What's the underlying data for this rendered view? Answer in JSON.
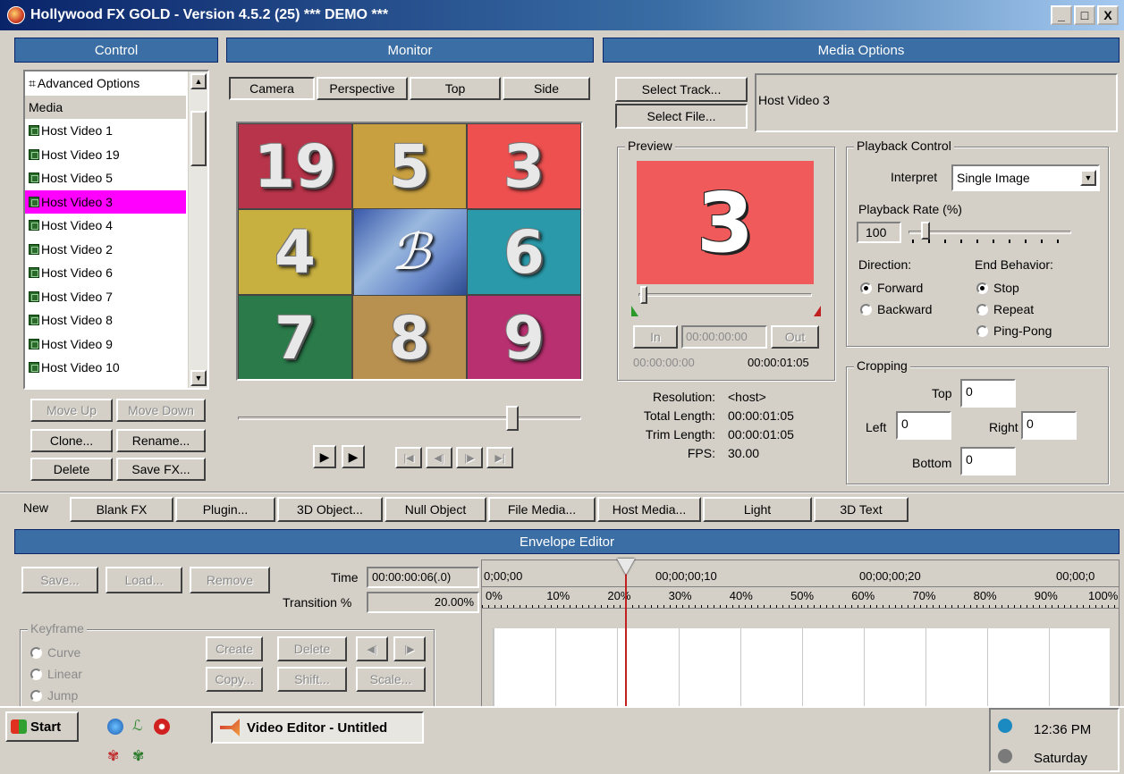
{
  "window": {
    "title": "Hollywood FX GOLD - Version 4.5.2 (25) *** DEMO ***",
    "buttons": {
      "minimize": "_",
      "maximize": "□",
      "close": "X"
    }
  },
  "control": {
    "header": "Control",
    "list_items": [
      {
        "label": "Advanced Options",
        "icon": "settings-icon"
      },
      {
        "label": "Media",
        "icon": ""
      },
      {
        "label": "Host Video 1",
        "icon": "film-icon"
      },
      {
        "label": "Host Video 19",
        "icon": "film-icon"
      },
      {
        "label": "Host Video 5",
        "icon": "film-icon"
      },
      {
        "label": "Host Video 3",
        "icon": "film-icon",
        "selected": true
      },
      {
        "label": "Host Video 4",
        "icon": "film-icon"
      },
      {
        "label": "Host Video 2",
        "icon": "film-icon"
      },
      {
        "label": "Host Video 6",
        "icon": "film-icon"
      },
      {
        "label": "Host Video 7",
        "icon": "film-icon"
      },
      {
        "label": "Host Video 8",
        "icon": "film-icon"
      },
      {
        "label": "Host Video 9",
        "icon": "film-icon"
      },
      {
        "label": "Host Video 10",
        "icon": "film-icon"
      }
    ],
    "move_up": "Move Up",
    "move_down": "Move Down",
    "clone": "Clone...",
    "rename": "Rename...",
    "delete": "Delete",
    "save_fx": "Save FX..."
  },
  "monitor": {
    "header": "Monitor",
    "tabs": [
      "Camera",
      "Perspective",
      "Top",
      "Side"
    ],
    "active_tab": "Camera",
    "tiles": [
      "19",
      "5",
      "3",
      "4",
      "6",
      "7",
      "8",
      "9"
    ],
    "tile_colors": [
      "#b8344a",
      "#c8a040",
      "#ee5050",
      "#c8b040",
      "#2a9aaa",
      "#2a7a4a",
      "#b89050",
      "#b83070"
    ],
    "slider_position": 0.78
  },
  "media_options": {
    "header": "Media Options",
    "select_track": "Select Track...",
    "select_file": "Select File...",
    "track_name": "Host Video 3",
    "preview": {
      "label": "Preview",
      "number": "3",
      "in_label": "In",
      "out_label": "Out",
      "in_time": "00:00:00:00",
      "start_time": "00:00:00:00",
      "end_time": "00:00:01:05"
    },
    "info": [
      {
        "key": "Resolution:",
        "value": "<host>"
      },
      {
        "key": "Total Length:",
        "value": "00:00:01:05"
      },
      {
        "key": "Trim Length:",
        "value": "00:00:01:05"
      },
      {
        "key": "FPS:",
        "value": "30.00"
      }
    ],
    "playback": {
      "label": "Playback Control",
      "interpret_label": "Interpret",
      "interpret_value": "Single Image",
      "rate_label": "Playback Rate (%)",
      "rate_value": "100",
      "direction_label": "Direction:",
      "end_behavior_label": "End Behavior:",
      "forward": "Forward",
      "backward": "Backward",
      "stop": "Stop",
      "repeat": "Repeat",
      "ping_pong": "Ping-Pong"
    },
    "cropping": {
      "label": "Cropping",
      "top_label": "Top",
      "left_label": "Left",
      "right_label": "Right",
      "bottom_label": "Bottom",
      "top": "0",
      "left": "0",
      "right": "0",
      "bottom": "0"
    }
  },
  "toolbar": {
    "new_label": "New",
    "buttons": [
      "Blank FX",
      "Plugin...",
      "3D Object...",
      "Null Object",
      "File Media...",
      "Host Media...",
      "Light",
      "3D Text"
    ]
  },
  "envelope": {
    "header": "Envelope Editor",
    "save": "Save...",
    "load": "Load...",
    "remove": "Remove",
    "time_label": "Time",
    "time_value": "00:00:00:06(.0)",
    "transition_label": "Transition %",
    "transition_value": "20.00%",
    "time_ticks": [
      "0;00;00",
      "00;00;00;10",
      "00;00;00;20",
      "00;00;0"
    ],
    "percent_ticks": [
      "0%",
      "10%",
      "20%",
      "30%",
      "40%",
      "50%",
      "60%",
      "70%",
      "80%",
      "90%",
      "100%"
    ],
    "playhead_fraction": 0.2,
    "keyframe_label": "Keyframe",
    "curve": "Curve",
    "linear": "Linear",
    "jump": "Jump",
    "create": "Create",
    "delete": "Delete",
    "copy": "Copy...",
    "shift": "Shift...",
    "scale": "Scale..."
  },
  "taskbar": {
    "start": "Start",
    "task": "Video Editor - Untitled",
    "time": "12:36 PM",
    "day": "Saturday"
  }
}
